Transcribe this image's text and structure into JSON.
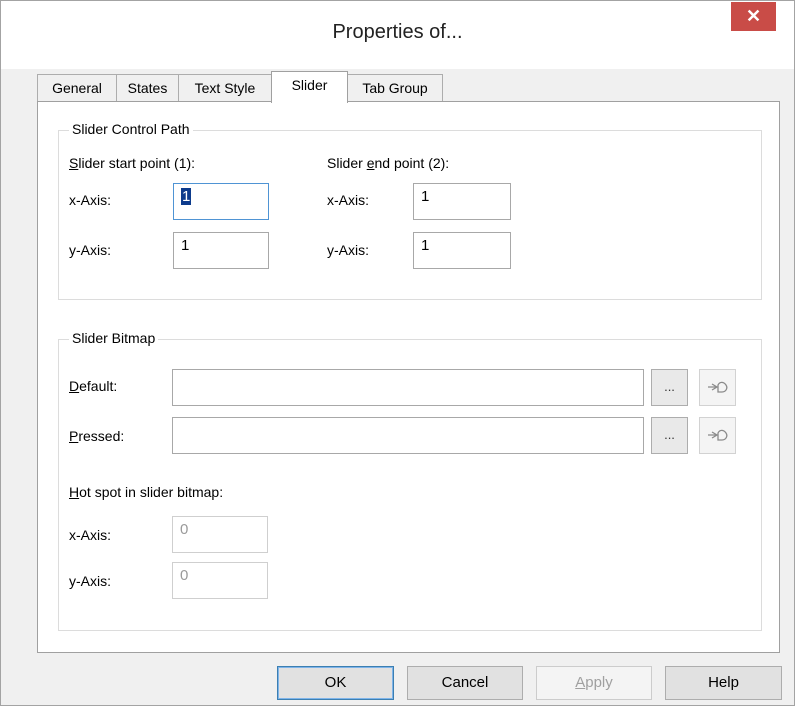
{
  "window": {
    "title": "Properties of...",
    "close_glyph": "✕"
  },
  "tabs": [
    "General",
    "States",
    "Text Style",
    "Slider",
    "Tab Group"
  ],
  "active_tab": "Slider",
  "control_path": {
    "group_title": "Slider Control Path",
    "start": {
      "title_pre": "",
      "title_key": "S",
      "title_post": "lider start point (1):",
      "x_label": "x-Axis:",
      "x_value": "1",
      "y_label": "y-Axis:",
      "y_value": "1"
    },
    "end": {
      "title_pre": "Slider ",
      "title_key": "e",
      "title_post": "nd point (2):",
      "x_label": "x-Axis:",
      "x_value": "1",
      "y_label": "y-Axis:",
      "y_value": "1"
    }
  },
  "bitmap": {
    "group_title": "Slider Bitmap",
    "default": {
      "label_key": "D",
      "label_rest": "efault:",
      "value": ""
    },
    "pressed": {
      "label_key": "P",
      "label_rest": "ressed:",
      "value": ""
    },
    "browse_label": "...",
    "picker_icon": "hand-pointer-icon",
    "hotspot": {
      "title_key": "H",
      "title_rest": "ot spot in slider bitmap:",
      "x_label": "x-Axis:",
      "x_value": "0",
      "y_label": "y-Axis:",
      "y_value": "0"
    }
  },
  "buttons": {
    "ok": "OK",
    "cancel": "Cancel",
    "apply_key": "A",
    "apply_rest": "pply",
    "help": "Help"
  },
  "colors": {
    "close": "#c94c47",
    "focus_border": "#4f94d4",
    "caret": "#0d3b8c"
  }
}
